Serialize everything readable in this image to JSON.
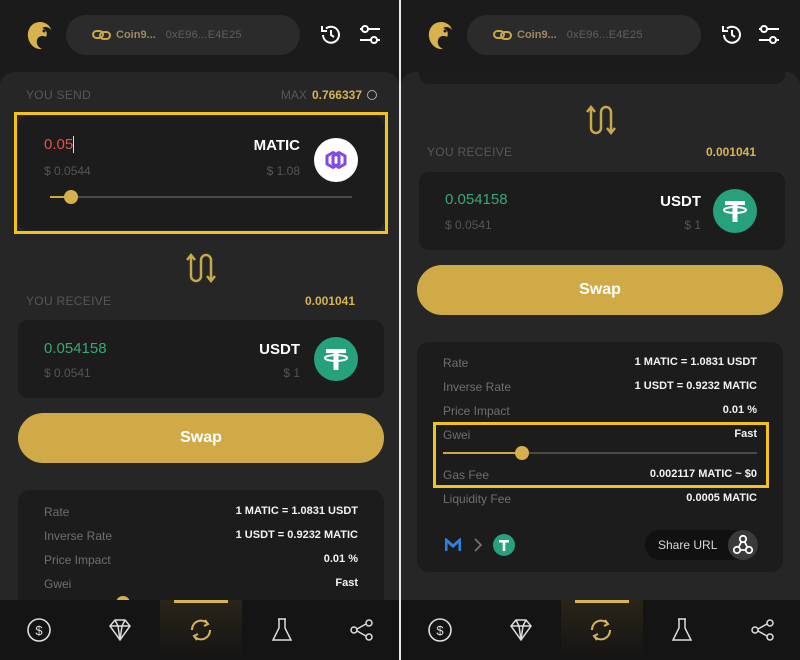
{
  "header": {
    "wallet_name": "Coin9...",
    "wallet_address": "0xE96...E4E25"
  },
  "send": {
    "label": "YOU SEND",
    "max_label": "MAX",
    "max_value": "0.766337",
    "amount": "0.05",
    "amount_usd": "$ 0.0544",
    "token": "MATIC",
    "token_price": "$ 1.08",
    "slider_fraction": 0.07
  },
  "receive": {
    "label": "YOU RECEIVE",
    "rate_value": "0.001041",
    "amount": "0.054158",
    "amount_usd": "$ 0.0541",
    "token": "USDT",
    "token_price": "$ 1"
  },
  "swap_button": "Swap",
  "details": {
    "rate_label": "Rate",
    "rate_value": "1 MATIC = 1.0831 USDT",
    "inverse_label": "Inverse Rate",
    "inverse_value": "1 USDT = 0.9232 MATIC",
    "impact_label": "Price Impact",
    "impact_value": "0.01 %",
    "gwei_label": "Gwei",
    "gwei_value": "Fast",
    "gwei_fraction": 0.25,
    "gas_label": "Gas Fee",
    "gas_value": "0.002117 MATIC ~ $0",
    "liquidity_label": "Liquidity Fee",
    "liquidity_value": "0.0005 MATIC"
  },
  "share": {
    "label": "Share URL"
  },
  "icons": {
    "logo": "dragon-logo-icon",
    "history": "history-icon",
    "settings": "sliders-icon",
    "nav": [
      "dollar-coin-icon",
      "diamond-icon",
      "swap-cycle-icon",
      "flask-icon",
      "share-nodes-icon"
    ]
  },
  "colors": {
    "accent": "#d6b552",
    "swap_button": "#cfaa47",
    "highlight": "#f4c31b",
    "matic": "#8247e5",
    "usdt": "#26a17b",
    "send_amount": "#e0524f",
    "receive_amount": "#3aa874"
  }
}
